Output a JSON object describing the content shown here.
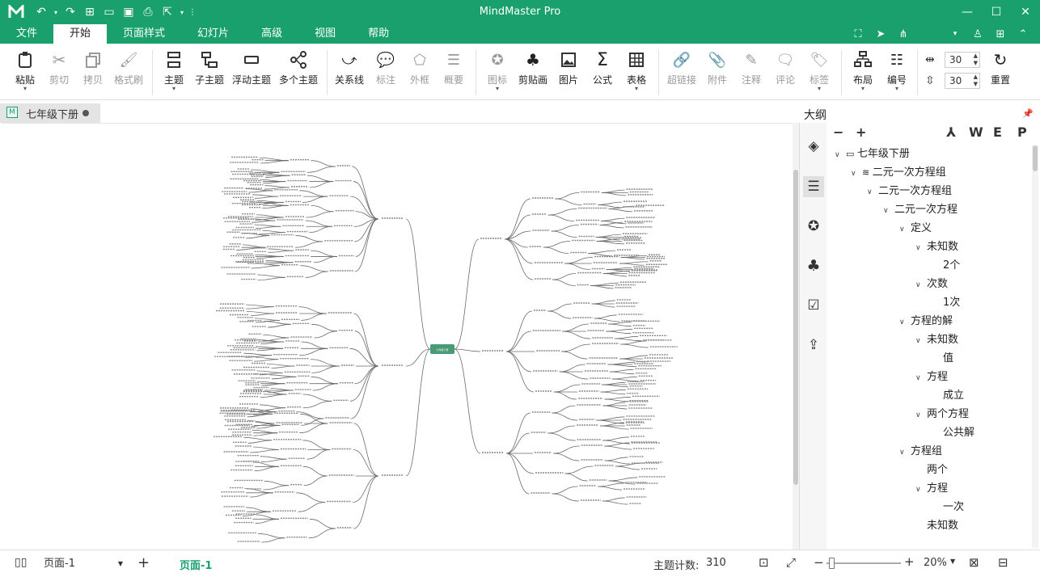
{
  "app": {
    "title": "MindMaster Pro"
  },
  "menu": {
    "tabs": [
      "文件",
      "开始",
      "页面样式",
      "幻灯片",
      "高级",
      "视图",
      "帮助"
    ],
    "active_index": 1
  },
  "ribbon": {
    "paste": "粘贴",
    "cut": "剪切",
    "copy": "拷贝",
    "format_painter": "格式刷",
    "topic": "主题",
    "subtopic": "子主题",
    "floating_topic": "浮动主题",
    "multiple_topics": "多个主题",
    "relationship": "关系线",
    "callout": "标注",
    "boundary": "外框",
    "summary": "概要",
    "icon": "图标",
    "clipart": "剪贴画",
    "image": "图片",
    "formula": "公式",
    "table": "表格",
    "hyperlink": "超链接",
    "attachment": "附件",
    "note": "注释",
    "comment": "评论",
    "tag": "标签",
    "layout": "布局",
    "numbering": "编号",
    "h_spacing": "30",
    "v_spacing": "30",
    "reset": "重置"
  },
  "document": {
    "tab_title": "七年级下册",
    "root_topic": "七年级下册"
  },
  "outline": {
    "title": "大纲",
    "tools": {
      "collapse": "−",
      "expand": "+",
      "word": "W",
      "excel": "E",
      "ppt": "P"
    },
    "items": [
      {
        "text": "七年级下册",
        "level": 0
      },
      {
        "text": "二元一次方程组",
        "level": 1
      },
      {
        "text": "二元一次方程组",
        "level": 2
      },
      {
        "text": "二元一次方程",
        "level": 3
      },
      {
        "text": "定义",
        "level": 4
      },
      {
        "text": "未知数",
        "level": 5
      },
      {
        "text": "2个",
        "level": 6
      },
      {
        "text": "次数",
        "level": 5
      },
      {
        "text": "1次",
        "level": 6
      },
      {
        "text": "方程的解",
        "level": 4
      },
      {
        "text": "未知数",
        "level": 5
      },
      {
        "text": "值",
        "level": 6
      },
      {
        "text": "方程",
        "level": 5
      },
      {
        "text": "成立",
        "level": 6
      },
      {
        "text": "两个方程",
        "level": 5
      },
      {
        "text": "公共解",
        "level": 6
      },
      {
        "text": "方程组",
        "level": 4
      },
      {
        "text": "两个",
        "level": 5
      },
      {
        "text": "方程",
        "level": 5
      },
      {
        "text": "一次",
        "level": 6
      },
      {
        "text": "未知数",
        "level": 5
      }
    ]
  },
  "status": {
    "page_select": "页面-1",
    "page_tab": "页面-1",
    "topic_count_label": "主题计数:",
    "topic_count": "310",
    "zoom_minus": "−",
    "zoom_plus": "+",
    "zoom": "20%"
  },
  "colors": {
    "brand": "#1aa06d",
    "root_node": "#4a9a78"
  }
}
